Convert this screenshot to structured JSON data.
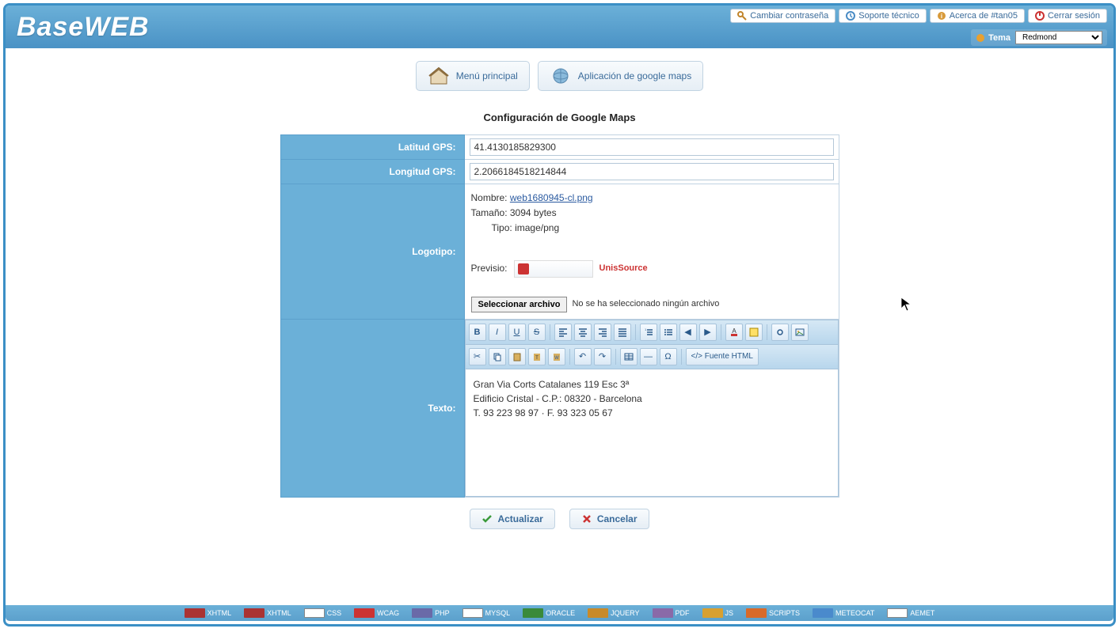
{
  "app": {
    "logo": "BaseWEB"
  },
  "topLinks": {
    "changePass": "Cambiar contraseña",
    "support": "Soporte técnico",
    "about": "Acerca de #tan05",
    "logout": "Cerrar sesión"
  },
  "theme": {
    "label": "Tema",
    "selected": "Redmond"
  },
  "menu": {
    "main": "Menú principal",
    "gmaps": "Aplicación de google maps"
  },
  "section": {
    "title": "Configuración de Google Maps"
  },
  "form": {
    "latLabel": "Latitud GPS:",
    "latValue": "41.4130185829300",
    "lngLabel": "Longitud GPS:",
    "lngValue": "2.2066184518214844",
    "logoLabel": "Logotipo:",
    "file": {
      "nameLabel": "Nombre:",
      "nameValue": "web1680945-cl.png",
      "sizeLabel": "Tamaño:",
      "sizeValue": "3094 bytes",
      "typeLabel": "Tipo:",
      "typeValue": "image/png"
    },
    "previewLabel": "Previsio:",
    "previewBrand": "UnisSource",
    "fileButton": "Seleccionar archivo",
    "fileStatus": "No se ha seleccionado ningún archivo",
    "textLabel": "Texto:",
    "textContent": {
      "line1": "Gran Via Corts Catalanes 119 Esc 3ª",
      "line2": "Edificio Cristal - C.P.: 08320 - Barcelona",
      "line3": "T. 93 223 98 97 · F. 93 323 05 67"
    }
  },
  "editor": {
    "sourceBtn": "Fuente HTML"
  },
  "actions": {
    "update": "Actualizar",
    "cancel": "Cancelar"
  },
  "footer": {
    "items": [
      "XHTML",
      "XHTML",
      "CSS",
      "WCAG",
      "PHP",
      "MYSQL",
      "ORACLE",
      "JQUERY",
      "PDF",
      "JS",
      "SCRIPTS",
      "METEOCAT",
      "AEMET"
    ]
  }
}
